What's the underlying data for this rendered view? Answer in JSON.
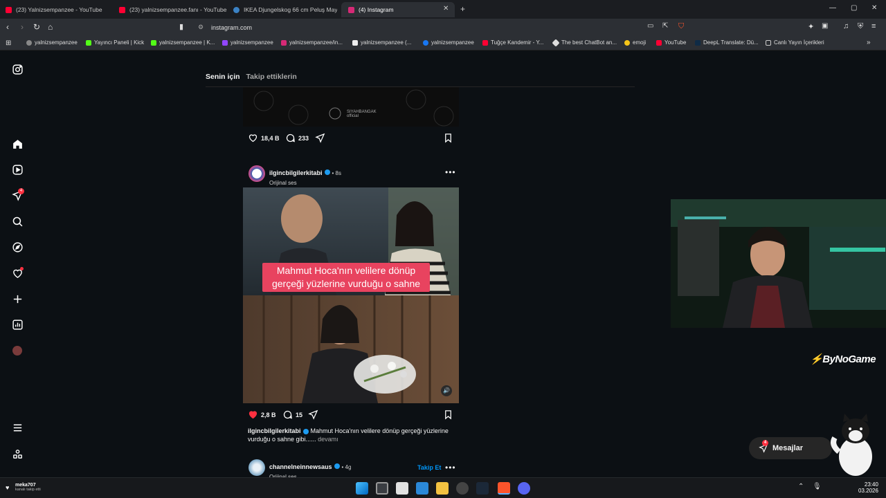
{
  "tabs": [
    {
      "title": "(23) Yalnizsempanzee - YouTube",
      "color": "#ff0033"
    },
    {
      "title": "(23) yalnizsempanzee.fanı - YouTube",
      "color": "#ff0033"
    },
    {
      "title": "IKEA Djungelskog 66 cm Peluş Maym",
      "color": "#3b82c4"
    },
    {
      "title": "(4) Instagram",
      "color": "#d62976"
    }
  ],
  "new_tab": "+",
  "address": {
    "url": "instagram.com"
  },
  "bookmarks": [
    {
      "label": "yalnizsempanzee",
      "color": "#888"
    },
    {
      "label": "Yayıncı Paneli | Kick",
      "color": "#53fc18"
    },
    {
      "label": "yalnizsempanzee | K...",
      "color": "#53fc18"
    },
    {
      "label": "yalnizsempanzee",
      "color": "#9146ff"
    },
    {
      "label": "yalnizsempanzee/in...",
      "color": "#d62976"
    },
    {
      "label": "yalnizsempanzee (...",
      "color": "#eee"
    },
    {
      "label": "yalnizsempanzee",
      "color": "#1877f2"
    },
    {
      "label": "Tuğçe Kandemir - Y...",
      "color": "#ff0033"
    },
    {
      "label": "The best ChatBot an...",
      "color": "#ddd"
    },
    {
      "label": "emoji",
      "color": "#f5c518"
    },
    {
      "label": "YouTube",
      "color": "#ff0033"
    },
    {
      "label": "DeepL Translate: Dü...",
      "color": "#0f2b46"
    },
    {
      "label": "Canlı Yayın İçerikleri",
      "color": "#555"
    }
  ],
  "sidebar": {
    "notif_badge": "4"
  },
  "feed": {
    "tab_active": "Senin için",
    "tab_inactive": "Takip ettiklerin",
    "prev_post": {
      "likes": "18,4 B",
      "comments": "233",
      "watermark": "SIYAHBANGAK official"
    },
    "post": {
      "username": "ilgincbilgilerkitabi",
      "age": "• 8s",
      "audio": "Orijinal ses",
      "video_caption": "Mahmut Hoca'nın velilere dönüp gerçeği yüzlerine vurduğu o sahne",
      "likes": "2,8 B",
      "comments": "15",
      "caption_user": "ilgincbilgilerkitabi",
      "caption_text": "Mahmut Hoca'nın velilere dönüp gerçeği yüzlerine vurduğu o sahne gibi......",
      "more": "devamı"
    },
    "next_post": {
      "username": "channelneinnewsaus",
      "age": "• 4g",
      "audio": "Orijinal ses",
      "follow": "Takip Et"
    }
  },
  "messages": {
    "label": "Mesajlar",
    "badge": "4"
  },
  "overlay": {
    "brand": "ByNoGame"
  },
  "stream": {
    "viewer_name": "meka707",
    "viewer_sub": "kanalı takip etti"
  },
  "clock": {
    "time": "23:40",
    "date": "03.2026"
  },
  "colors": {
    "bg": "#0c1014",
    "like": "#ff3040",
    "follow": "#0095f6",
    "caption": "#e8435f"
  }
}
